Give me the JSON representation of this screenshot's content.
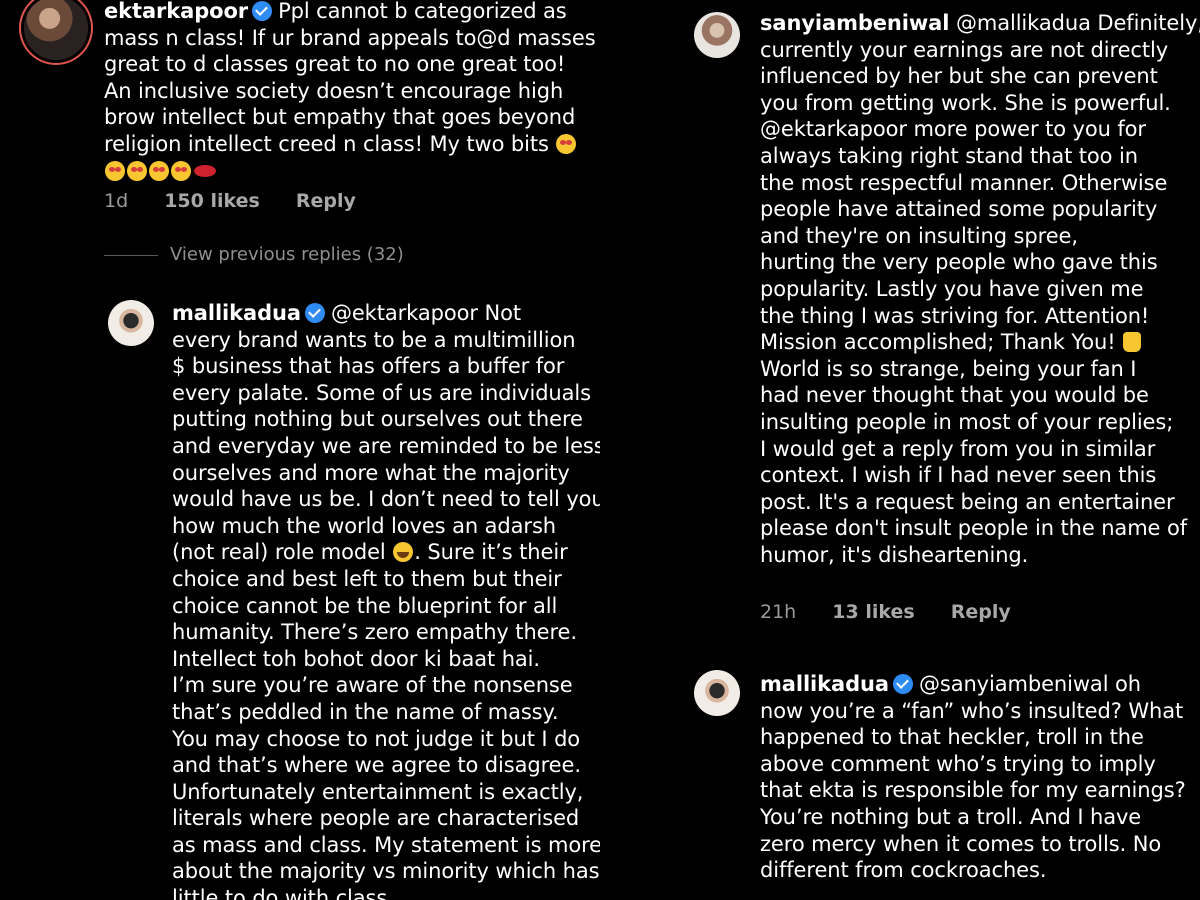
{
  "left": {
    "comment1": {
      "username": "ektarkapoor",
      "lines": [
        "Ppl cannot b categorized as",
        "mass n class! If ur brand appeals to@d masses",
        "great to d classes great to no one great too!",
        "An inclusive society doesn’t encourage high",
        "brow intellect but empathy that goes beyond",
        "religion intellect creed n class! My two bits"
      ],
      "time": "1d",
      "likes": "150 likes",
      "reply": "Reply"
    },
    "view_previous": "View previous replies (32)",
    "comment2": {
      "username": "mallikadua",
      "first_line": "@ektarkapoor Not",
      "lines": [
        "every brand wants to be a multimillion",
        "$ business that has offers a buffer for",
        "every palate. Some of us are individuals",
        "putting nothing but ourselves out there",
        "and everyday we are reminded to be less",
        "ourselves and more what the majority",
        "would have us be. I don’t need to tell you",
        "how much the world loves an adarsh",
        "(not real) role model",
        ". Sure it’s their",
        "choice and best left to them but their",
        "choice cannot be the blueprint for all",
        "humanity. There’s zero empathy there.",
        "Intellect toh bohot door ki baat hai.",
        "I’m sure you’re aware of the nonsense",
        "that’s peddled in the name of massy.",
        "You may choose to not judge it but I do",
        "and that’s where we agree to disagree.",
        "Unfortunately entertainment is exactly,",
        "literals where people are characterised",
        "as mass and class. My statement is more",
        "about the majority vs minority which has",
        "little to do with class."
      ]
    }
  },
  "right": {
    "comment1": {
      "username": "sanyiambeniwal",
      "first_line": "@mallikadua Definitely,",
      "lines": [
        "currently your earnings are not directly",
        "influenced by her but  she can prevent",
        "you from getting work. She is powerful.",
        "@ektarkapoor more power to you for",
        "always taking right stand that too in",
        "the most respectful manner. Otherwise",
        "people have attained some popularity",
        "and they're on insulting spree,",
        "hurting the very people who gave this",
        "popularity. Lastly you have given me",
        "the thing I was striving for. Attention!",
        "Mission accomplished; Thank You!",
        "World is so strange, being your fan I",
        "had never thought that you would be",
        "insulting people in most of your replies;",
        "I would get a reply from you in similar",
        "context. I wish if I had never seen this",
        "post. It's a request being an entertainer",
        "please don't insult people in the name of",
        "humor, it's disheartening."
      ],
      "time": "21h",
      "likes": "13 likes",
      "reply": "Reply"
    },
    "comment2": {
      "username": "mallikadua",
      "first_line": "@sanyiambeniwal oh",
      "lines": [
        "now you’re a “fan” who’s insulted? What",
        "happened to that heckler, troll in the",
        "above comment who’s trying to imply",
        "that ekta is responsible for my earnings?",
        "You’re nothing but a troll. And I have",
        "zero mercy when it comes to trolls. No",
        "different from cockroaches."
      ]
    }
  }
}
